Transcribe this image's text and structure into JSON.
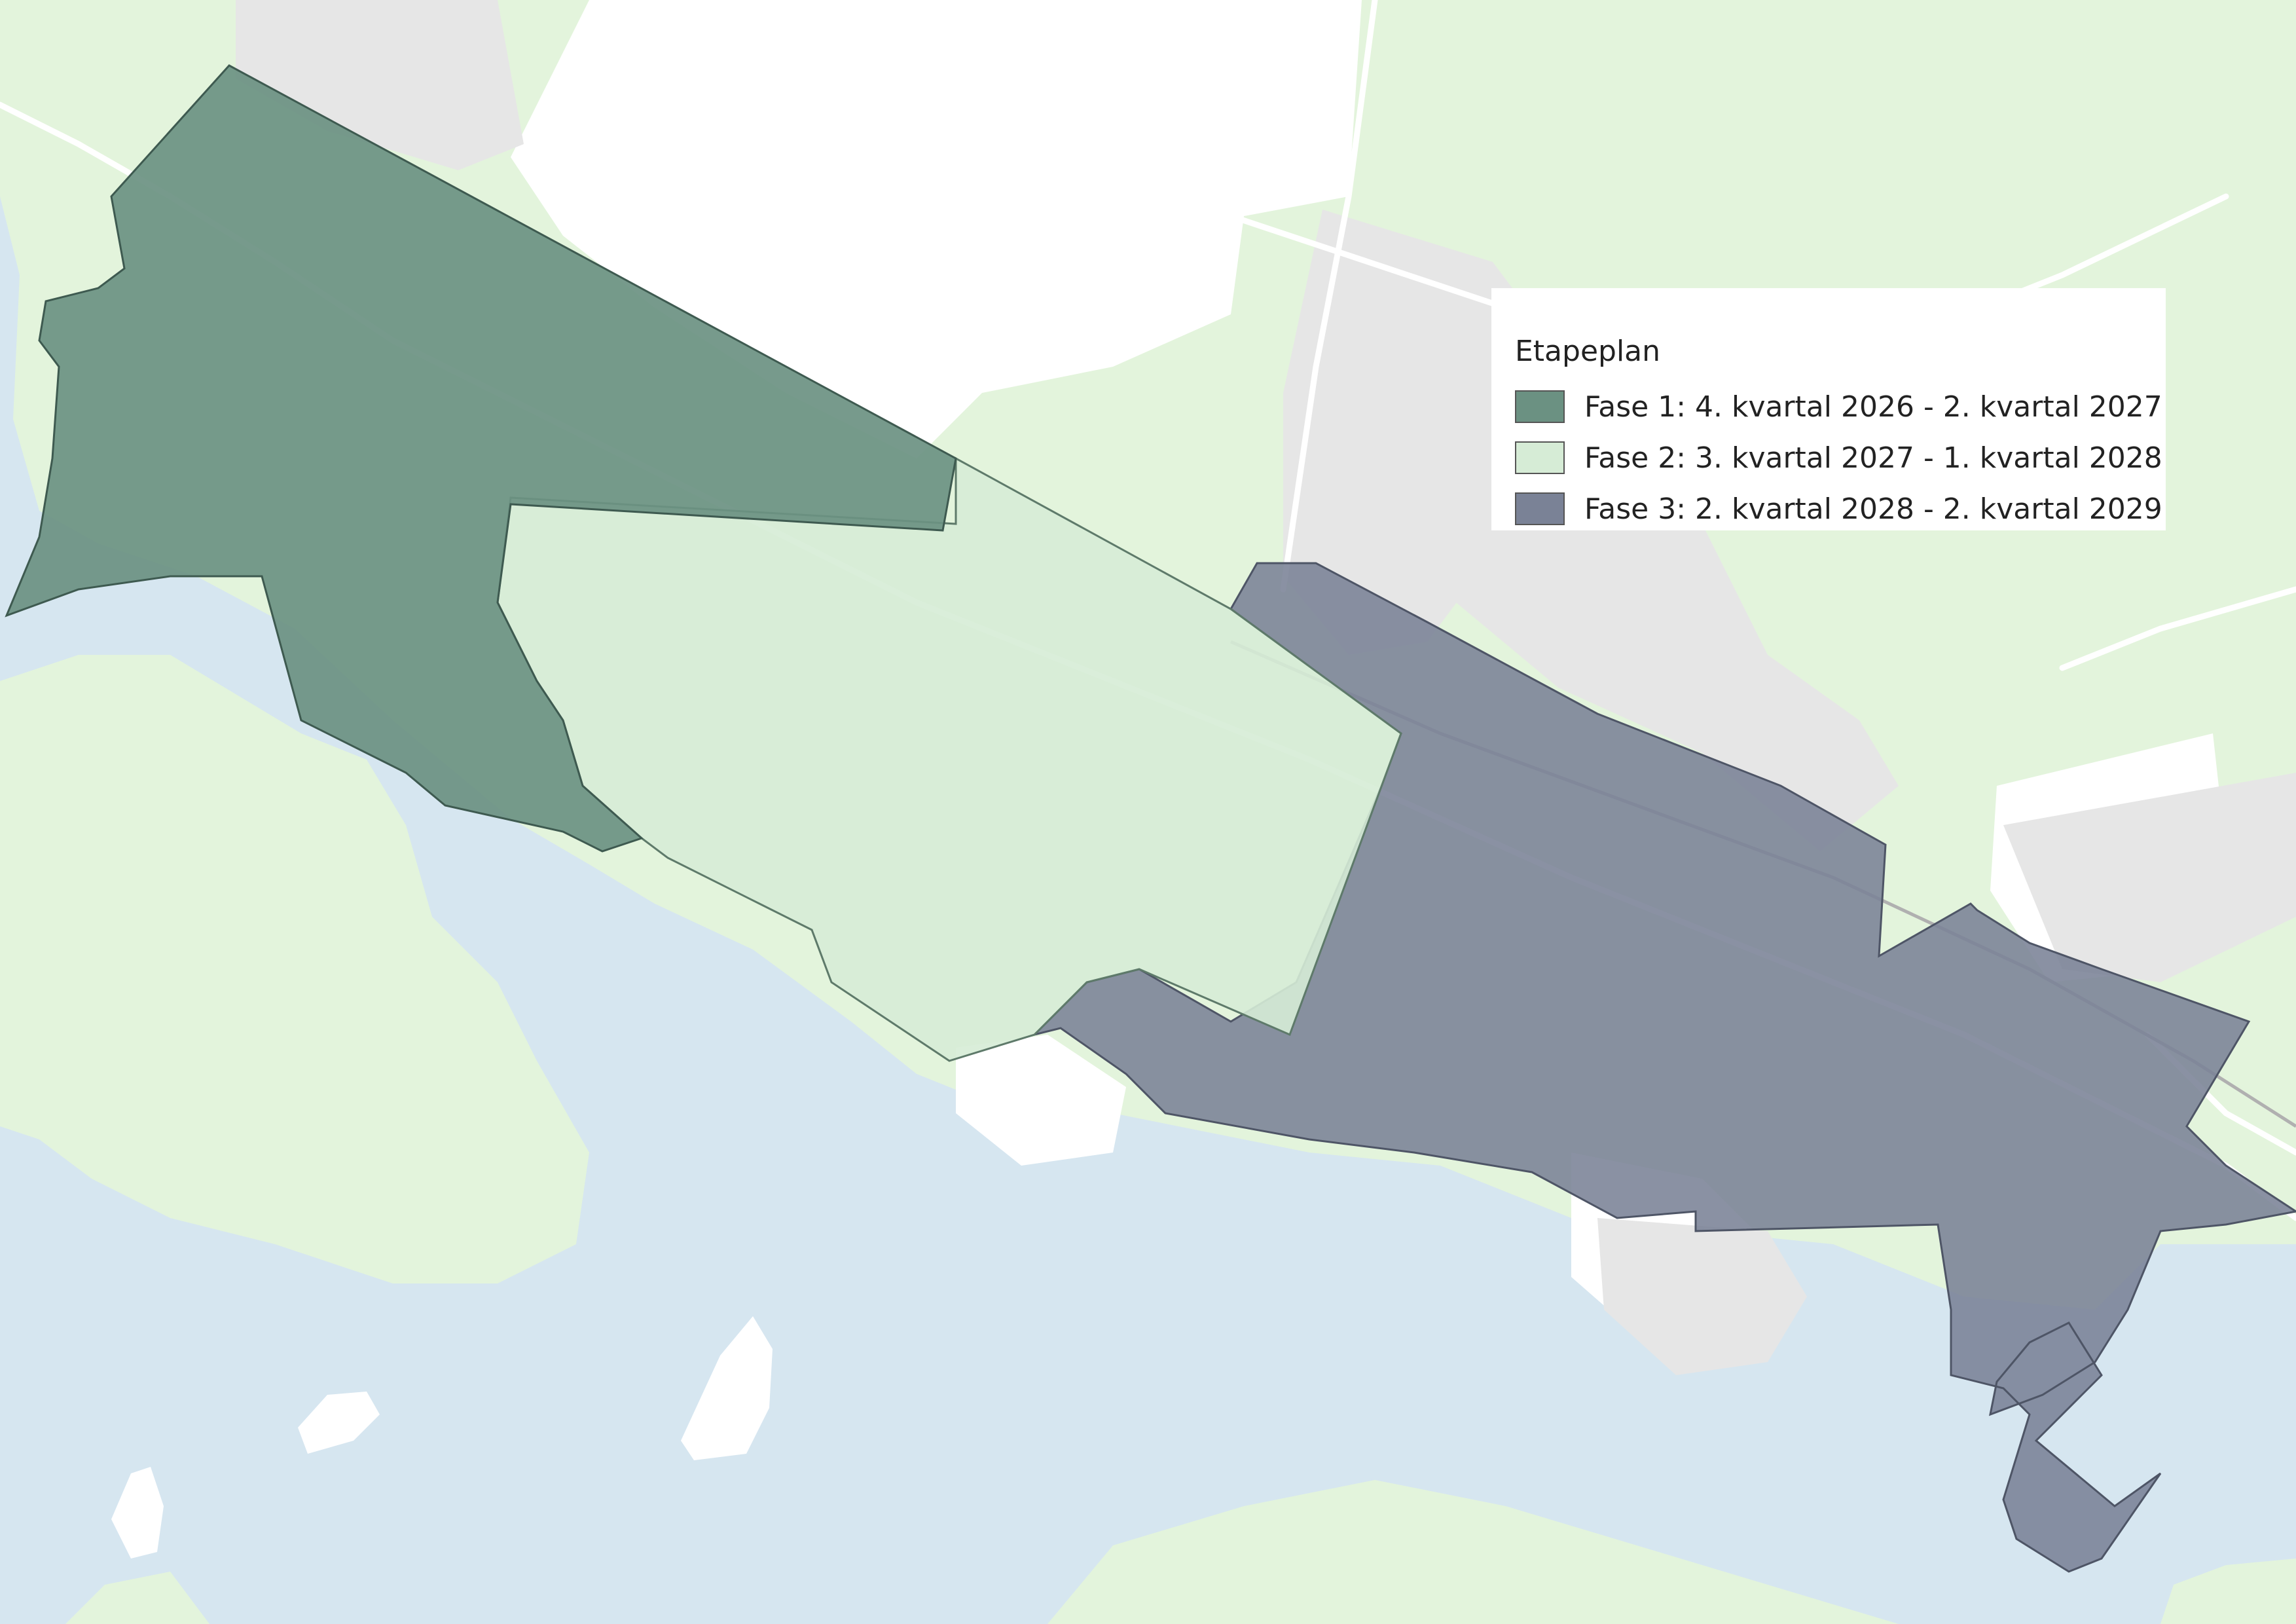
{
  "legend": {
    "title": "Etapeplan",
    "items": [
      {
        "label": "Fase 1: 4. kvartal 2026 - 2. kvartal 2027",
        "color": "#6b9182"
      },
      {
        "label": "Fase 2: 3. kvartal 2027 - 1. kvartal 2028",
        "color": "#d6ecd6"
      },
      {
        "label": "Fase 3: 2. kvartal 2028 - 2. kvartal 2029",
        "color": "#7a8296"
      }
    ]
  },
  "colors": {
    "water": "#d6e6f0",
    "forest": "#e3f4dc",
    "open_land": "#ffffff",
    "built_area": "#e6e6e6",
    "road": "#ffffff"
  }
}
